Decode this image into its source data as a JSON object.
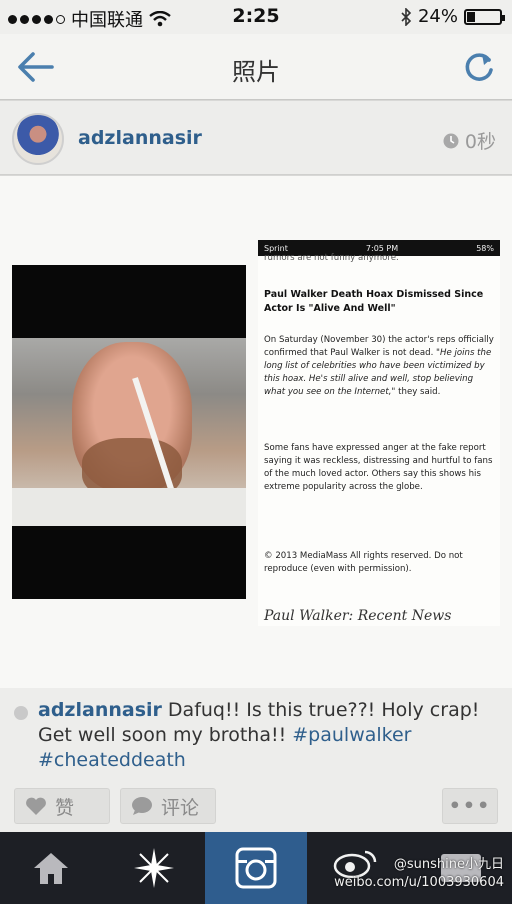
{
  "status_bar": {
    "carrier": "中国联通",
    "time": "2:25",
    "battery": "24%",
    "battery_level": 0.24
  },
  "nav": {
    "title": "照片"
  },
  "post": {
    "username": "adzlannasir",
    "time_ago": "0秒"
  },
  "photo": {
    "phone_status": {
      "carrier": "Sprint",
      "time": "7:05 PM",
      "battery": "58%"
    },
    "cut_line": "rumors are not funny anymore.",
    "headline": "Paul Walker Death Hoax Dismissed Since Actor Is \"Alive And Well\"",
    "para1_plain": "On Saturday (November 30) the actor's reps officially confirmed that Paul Walker is not dead. ",
    "para1_italic": "\"He joins the long list of celebrities who have been victimized by this hoax. He's still alive and well, stop believing what you see on the Internet,\"",
    "para1_end": " they said.",
    "para2": "Some fans have expressed anger at the fake report saying it was reckless, distressing and hurtful to fans of the much loved actor. Others say this shows his extreme popularity across the globe.",
    "copyright": "© 2013 MediaMass All rights reserved. Do not reproduce (even with permission).",
    "footer": "Paul Walker: Recent News"
  },
  "caption": {
    "username": "adzlannasir",
    "text": " Dafuq!! Is this true??! Holy crap! Get well soon my brotha!! ",
    "tag1": "#paulwalker",
    "tag2": "#cheateddeath"
  },
  "actions": {
    "like": "赞",
    "comment": "评论",
    "more": "•••"
  },
  "watermark": {
    "handle": "@sunshine小九日",
    "url": "weibo.com/u/1003930604"
  }
}
